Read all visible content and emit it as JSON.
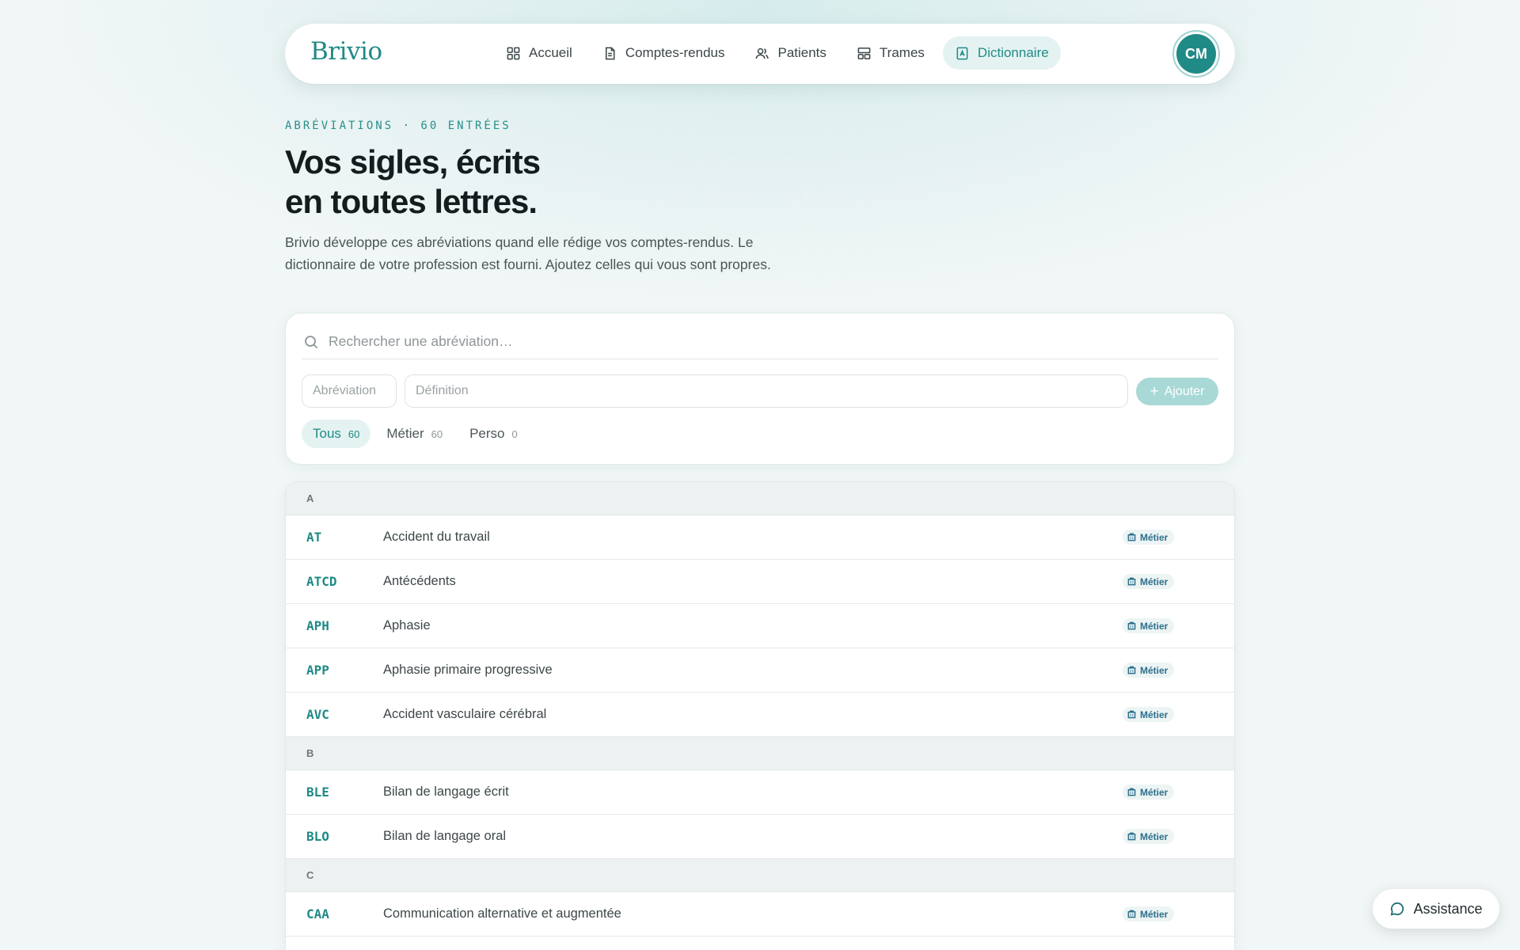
{
  "brand": "Brivio",
  "nav": {
    "items": [
      {
        "label": "Accueil",
        "icon": "grid-icon"
      },
      {
        "label": "Comptes-rendus",
        "icon": "document-icon"
      },
      {
        "label": "Patients",
        "icon": "users-icon"
      },
      {
        "label": "Trames",
        "icon": "layout-icon"
      },
      {
        "label": "Dictionnaire",
        "icon": "book-icon",
        "active": true
      }
    ],
    "avatar": "CM"
  },
  "hero": {
    "eyebrow": "ABRÉVIATIONS · 60 ENTRÉES",
    "title_line1": "Vos sigles, écrits",
    "title_line2": "en toutes lettres.",
    "lead": "Brivio développe ces abréviations quand elle rédige vos comptes-rendus. Le dictionnaire de votre profession est fourni. Ajoutez celles qui vous sont propres."
  },
  "search": {
    "placeholder": "Rechercher une abréviation…"
  },
  "add_form": {
    "abbr_placeholder": "Abréviation",
    "def_placeholder": "Définition",
    "button_label": "Ajouter"
  },
  "filters": [
    {
      "label": "Tous",
      "count": "60",
      "active": true
    },
    {
      "label": "Métier",
      "count": "60"
    },
    {
      "label": "Perso",
      "count": "0"
    }
  ],
  "groups": [
    {
      "letter": "A",
      "rows": [
        {
          "abbr": "AT",
          "def": "Accident du travail",
          "badge": "Métier"
        },
        {
          "abbr": "ATCD",
          "def": "Antécédents",
          "badge": "Métier"
        },
        {
          "abbr": "APH",
          "def": "Aphasie",
          "badge": "Métier"
        },
        {
          "abbr": "APP",
          "def": "Aphasie primaire progressive",
          "badge": "Métier"
        },
        {
          "abbr": "AVC",
          "def": "Accident vasculaire cérébral",
          "badge": "Métier"
        }
      ]
    },
    {
      "letter": "B",
      "rows": [
        {
          "abbr": "BLE",
          "def": "Bilan de langage écrit",
          "badge": "Métier"
        },
        {
          "abbr": "BLO",
          "def": "Bilan de langage oral",
          "badge": "Métier"
        }
      ]
    },
    {
      "letter": "C",
      "rows": [
        {
          "abbr": "CAA",
          "def": "Communication alternative et augmentée",
          "badge": "Métier"
        }
      ]
    }
  ],
  "assistance": "Assistance",
  "colors": {
    "accent": "#1f8a86",
    "background": "#f1f6f6"
  }
}
